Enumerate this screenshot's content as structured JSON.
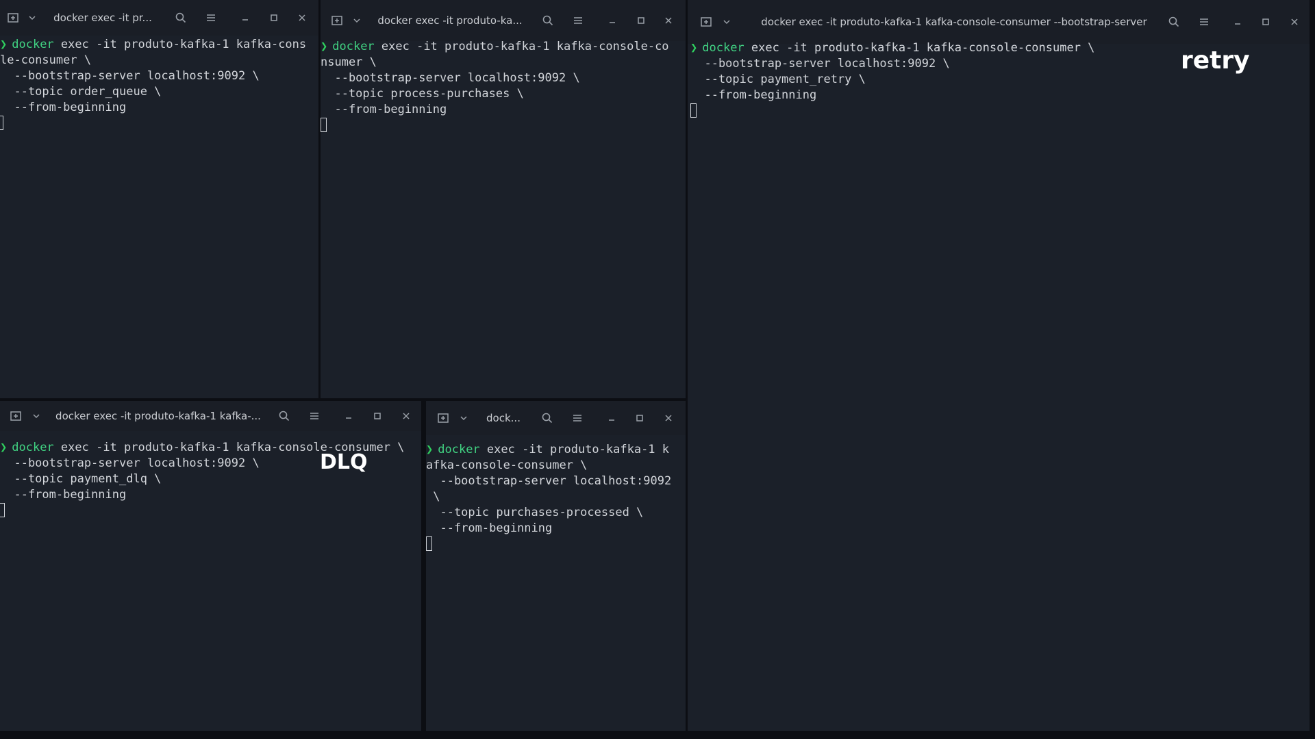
{
  "terminals": [
    {
      "title": "docker exec -it pr...",
      "prompt": "❯",
      "lines": [
        {
          "cmd": "docker",
          "text": " exec -it produto-kafka-1 kafka-cons"
        },
        {
          "text": "le-consumer \\"
        },
        {
          "text": "  --bootstrap-server localhost:9092 \\"
        },
        {
          "text": "  --topic order_queue \\"
        },
        {
          "text": "  --from-beginning"
        }
      ]
    },
    {
      "title": "docker exec -it produto-ka...",
      "prompt": "❯",
      "lines": [
        {
          "cmd": "docker",
          "text": " exec -it produto-kafka-1 kafka-console-co"
        },
        {
          "text": "nsumer \\"
        },
        {
          "text": "  --bootstrap-server localhost:9092 \\"
        },
        {
          "text": "  --topic process-purchases \\"
        },
        {
          "text": "  --from-beginning"
        }
      ]
    },
    {
      "title": "docker exec -it produto-kafka-1 kafka-console-consumer --bootstrap-server",
      "prompt": "❯",
      "lines": [
        {
          "cmd": "docker",
          "text": " exec -it produto-kafka-1 kafka-console-consumer \\"
        },
        {
          "text": "  --bootstrap-server localhost:9092 \\"
        },
        {
          "text": "  --topic payment_retry \\"
        },
        {
          "text": "  --from-beginning"
        }
      ]
    },
    {
      "title": "docker exec -it produto-kafka-1 kafka-...",
      "prompt": "❯",
      "lines": [
        {
          "cmd": "docker",
          "text": " exec -it produto-kafka-1 kafka-console-consumer \\"
        },
        {
          "text": "  --bootstrap-server localhost:9092 \\"
        },
        {
          "text": "  --topic payment_dlq \\"
        },
        {
          "text": "  --from-beginning"
        }
      ]
    },
    {
      "title": "dock...",
      "prompt": "❯",
      "lines": [
        {
          "cmd": "docker",
          "text": " exec -it produto-kafka-1 k"
        },
        {
          "text": "afka-console-consumer \\"
        },
        {
          "text": "  --bootstrap-server localhost:9092"
        },
        {
          "text": " \\"
        },
        {
          "text": "  --topic purchases-processed \\"
        },
        {
          "text": "  --from-beginning"
        }
      ]
    }
  ],
  "labels": {
    "retry": "retry",
    "dlq": "DLQ"
  },
  "icons": [
    "new-tab-icon",
    "chevron-down-icon",
    "search-icon",
    "menu-icon",
    "minimize-icon",
    "maximize-icon",
    "close-icon"
  ],
  "colors": {
    "prompt": "#2fd15f",
    "command": "#41d483",
    "terminal_bg": "#1b2029",
    "titlebar_bg": "#1a1e26"
  }
}
